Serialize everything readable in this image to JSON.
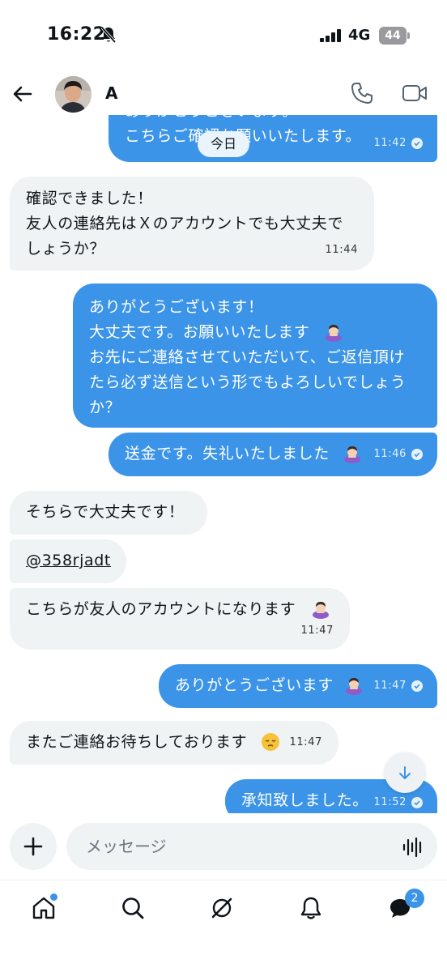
{
  "status_bar": {
    "time": "16:22",
    "network": "4G",
    "battery": "44"
  },
  "header": {
    "contact_name": "A"
  },
  "date_separator": "今日",
  "messages": [
    {
      "dir": "out",
      "text": "ありがとうございます。\nこちらご確認お願いいたします。",
      "time": "11:42"
    },
    {
      "dir": "in",
      "text": "確認できました！\n友人の連絡先はＸのアカウントでも大丈夫で\nしょうか？",
      "time": "11:44"
    },
    {
      "dir": "out",
      "text": "ありがとうございます！\n大丈夫です。お願いいたします\nお先にご連絡させていただいて、ご返信頂け\nたら必ず送信という形でもよろしいでしょう\nか？",
      "time": ""
    },
    {
      "dir": "out",
      "text": "送金です。失礼いたしました",
      "time": "11:46"
    },
    {
      "dir": "in",
      "text": "そちらで大丈夫です！",
      "time": ""
    },
    {
      "dir": "in",
      "text": "@358rjadt",
      "time": ""
    },
    {
      "dir": "in",
      "text": "こちらが友人のアカウントになります",
      "time": "11:47"
    },
    {
      "dir": "out",
      "text": "ありがとうございます",
      "time": "11:47"
    },
    {
      "dir": "in",
      "text": "またご連絡お待ちしております",
      "time": "11:47"
    },
    {
      "dir": "out",
      "text": "承知致しました。",
      "time": "11:52"
    }
  ],
  "composer": {
    "placeholder": "メッセージ"
  },
  "tab_bar": {
    "messages_badge": "2"
  },
  "colors": {
    "outgoing_bubble": "#3b94e8",
    "incoming_bubble": "#eff3f4",
    "accent": "#3b94e8"
  }
}
